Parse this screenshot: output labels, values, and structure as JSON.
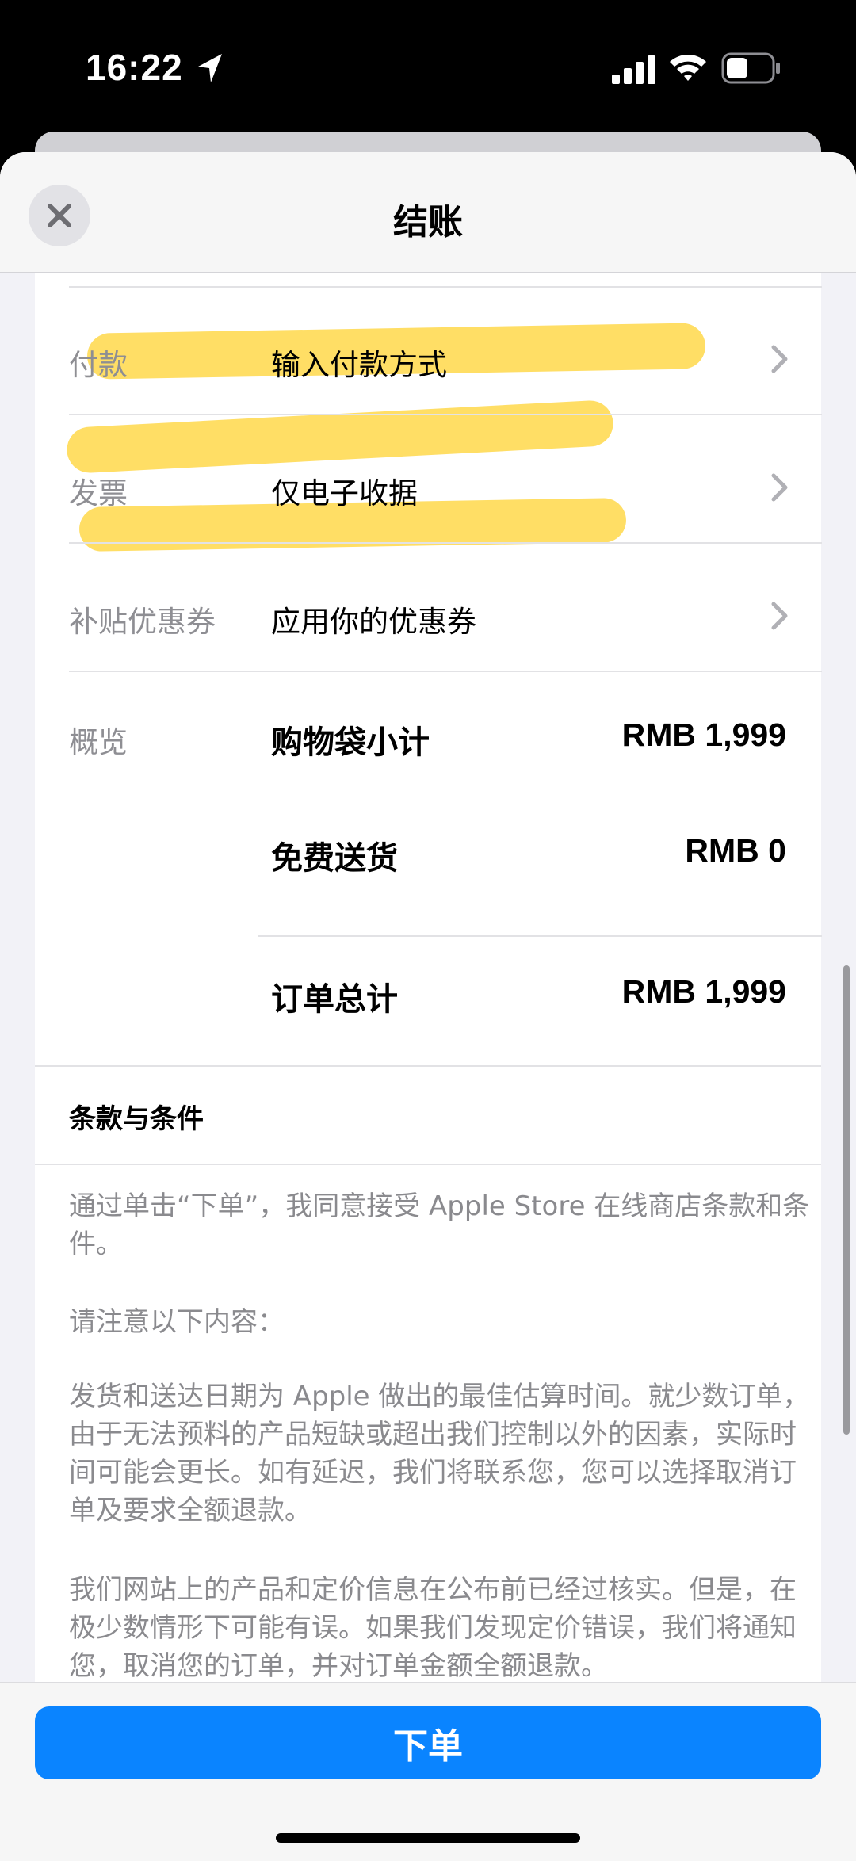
{
  "status_bar": {
    "time": "16:22",
    "icons": [
      "location-arrow-icon",
      "cellular-signal-icon",
      "wifi-icon",
      "battery-icon"
    ]
  },
  "nav": {
    "title": "结账",
    "close_icon": "close-icon"
  },
  "rows": [
    {
      "label": "付款",
      "value": "输入付款方式",
      "chevron": "chevron-right-icon"
    },
    {
      "label": "发票",
      "value": "仅电子收据",
      "chevron": "chevron-right-icon"
    },
    {
      "label": "补贴优惠券",
      "value": "应用你的优惠券",
      "chevron": "chevron-right-icon"
    }
  ],
  "summary": {
    "label": "概览",
    "lines": [
      {
        "name": "购物袋小计",
        "amount": "RMB 1,999"
      },
      {
        "name": "免费送货",
        "amount": "RMB 0"
      },
      {
        "name": "订单总计",
        "amount": "RMB 1,999"
      }
    ]
  },
  "terms": {
    "heading": "条款与条件",
    "paragraphs": [
      "通过单击“下单”，我同意接受 Apple Store 在线商店条款和条件。",
      "请注意以下内容：",
      "发货和送达日期为 Apple 做出的最佳估算时间。就少数订单，由于无法预料的产品短缺或超出我们控制以外的因素，实际时间可能会更长。如有延迟，我们将联系您，您可以选择取消订单及要求全额退款。",
      "我们网站上的产品和定价信息在公布前已经过核实。但是，在极少数情形下可能有误。如果我们发现定价错误，我们将通知您，取消您的订单，并对订单金额全额退款。"
    ]
  },
  "footer": {
    "place_order_label": "下单"
  },
  "colors": {
    "accent": "#0a84ff",
    "highlighter": "#ffd84a",
    "secondary_text": "#8e8e93"
  }
}
